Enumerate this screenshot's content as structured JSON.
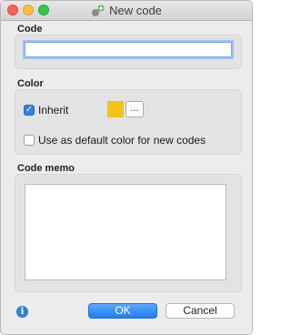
{
  "window": {
    "title": "New code"
  },
  "code_section": {
    "label": "Code",
    "value": "",
    "placeholder": ""
  },
  "color_section": {
    "label": "Color",
    "inherit_label": "Inherit",
    "inherit_checked": true,
    "swatch_color": "#f2c318",
    "browse_label": "...",
    "default_label": "Use as default color for new codes",
    "default_checked": false
  },
  "memo_section": {
    "label": "Code memo",
    "value": ""
  },
  "footer": {
    "info_icon": "i",
    "ok_label": "OK",
    "cancel_label": "Cancel"
  },
  "colors": {
    "accent": "#2f80e6",
    "window_bg": "#ececec"
  }
}
